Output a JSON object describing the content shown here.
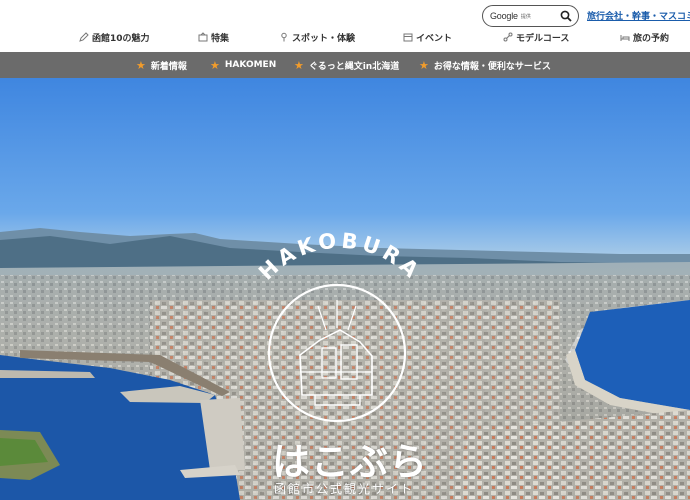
{
  "header": {
    "search": {
      "brand": "Google",
      "sub": "提供"
    },
    "agency_link": "旅行会社・幹事・マスコミ"
  },
  "main_nav": [
    {
      "label": "函館10の魅力",
      "icon": "pencil-icon"
    },
    {
      "label": "特集",
      "icon": "book-icon"
    },
    {
      "label": "スポット・体験",
      "icon": "pin-icon"
    },
    {
      "label": "イベント",
      "icon": "calendar-icon"
    },
    {
      "label": "モデルコース",
      "icon": "route-icon"
    },
    {
      "label": "旅の予約",
      "icon": "bed-icon"
    }
  ],
  "sub_nav": [
    {
      "label": "新着情報"
    },
    {
      "label": "HAKOMEN"
    },
    {
      "label": "ぐるっと縄文in北海道"
    },
    {
      "label": "お得な情報・便利なサービス"
    }
  ],
  "hero": {
    "arc_text": "HAKOBURA",
    "logo_title": "はこぶら",
    "logo_sub": "函館市公式観光サイト"
  },
  "colors": {
    "subnav_bg": "#6b6b6b",
    "star": "#f29c2b",
    "link": "#1a5cab",
    "sky": "#4f8fe0",
    "sea": "#1d5fb8"
  }
}
